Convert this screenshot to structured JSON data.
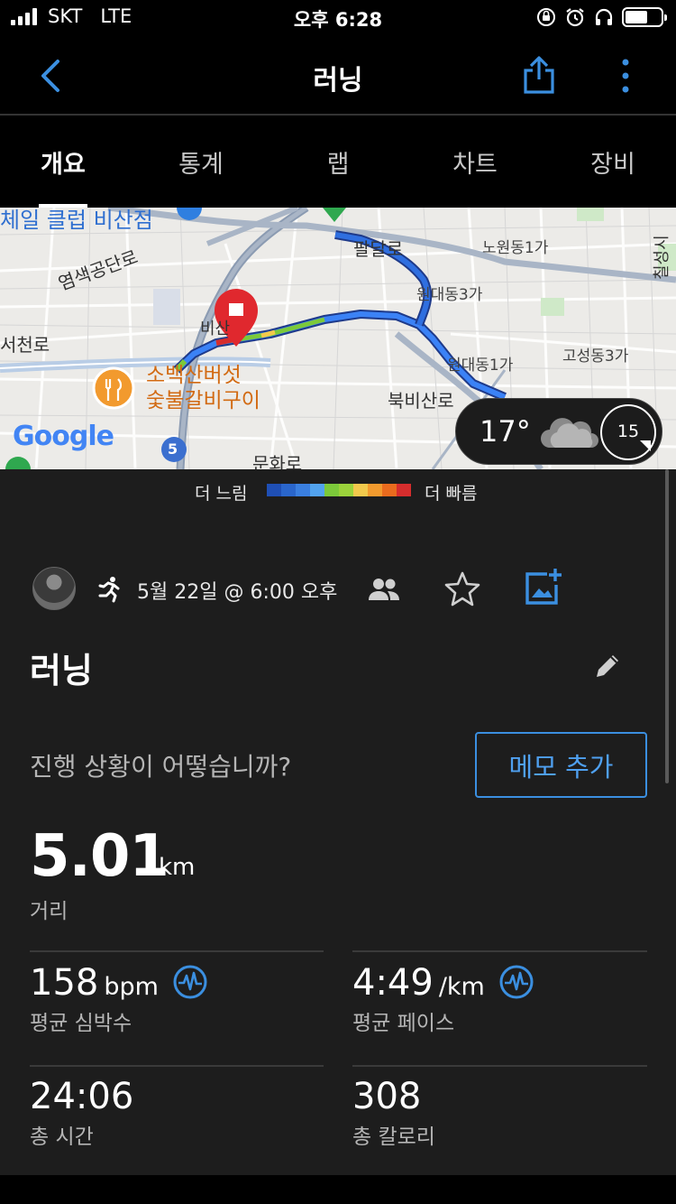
{
  "status_bar": {
    "carrier": "SKT",
    "network": "LTE",
    "time": "오후 6:28"
  },
  "nav": {
    "title": "러닝"
  },
  "tabs": [
    {
      "label": "개요",
      "active": true
    },
    {
      "label": "통계",
      "active": false
    },
    {
      "label": "랩",
      "active": false
    },
    {
      "label": "차트",
      "active": false
    },
    {
      "label": "장비",
      "active": false
    }
  ],
  "map": {
    "labels": {
      "top_left": "체일 클럽 비산점",
      "road1": "염색공단로",
      "road2": "서천로",
      "road3": "팔달로",
      "area1": "노원동1가",
      "area2": "원대동3가",
      "area3": "원대동1가",
      "area4": "고성동3가",
      "road4": "북비산로",
      "road5": "문화로",
      "poi_name": "소백산버섯\n숯불갈비구이",
      "road_badge": "5",
      "short1": "비산",
      "edge_right": "칠성시"
    },
    "google_logo": "Google",
    "weather": {
      "temperature": "17°",
      "wind_speed": "15",
      "condition_icon": "cloud-icon"
    }
  },
  "legend": {
    "slow_label": "더 느림",
    "fast_label": "더 빠름",
    "colors": [
      "#1f4fb5",
      "#2a66cc",
      "#3a7fe0",
      "#52a3ef",
      "#7cc93a",
      "#9bd23b",
      "#f2c94c",
      "#f29a2e",
      "#ea6b1e",
      "#d62d2d"
    ]
  },
  "activity": {
    "date": "5월 22일 @ 6:00 오후",
    "title": "러닝",
    "question": "진행 상황이 어떻습니까?",
    "memo_button": "메모 추가"
  },
  "stats": {
    "distance": {
      "value": "5.01",
      "unit": "km",
      "label": "거리"
    },
    "heart_rate": {
      "value": "158",
      "unit": "bpm",
      "label": "평균 심박수"
    },
    "pace": {
      "value": "4:49",
      "unit": "/km",
      "label": "평균 페이스"
    },
    "time": {
      "value": "24:06",
      "label": "총 시간"
    },
    "calories": {
      "value": "308",
      "label": "총 칼로리"
    }
  },
  "colors": {
    "accent": "#3b8fe0",
    "background": "#1d1d1d"
  }
}
